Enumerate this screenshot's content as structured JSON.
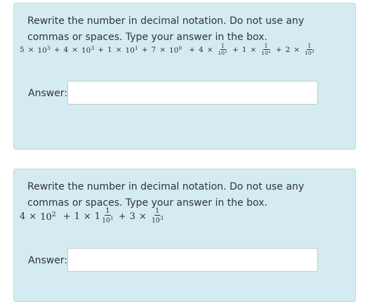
{
  "questions": [
    {
      "prompt": "Rewrite the number in decimal notation. Do not use any commas or spaces. Type your answer in the box.",
      "expression": {
        "t1_coef": "5",
        "t1_base": "10",
        "t1_exp": "3",
        "t2_coef": "4",
        "t2_base": "10",
        "t2_exp": "3",
        "t3_coef": "1",
        "t3_base": "10",
        "t3_exp": "1",
        "t4_coef": "7",
        "t4_base": "10",
        "t4_exp": "0",
        "t5_coef": "4",
        "t5_num": "1",
        "t5_base": "10",
        "t5_exp": "1",
        "t6_coef": "1",
        "t6_num": "1",
        "t6_base": "10",
        "t6_exp": "2",
        "t7_coef": "2",
        "t7_num": "1",
        "t7_base": "10",
        "t7_exp": "3",
        "times": "×",
        "plus": "+"
      },
      "answer_label": "Answer:",
      "answer_value": ""
    },
    {
      "prompt": "Rewrite the number in decimal notation. Do not use any commas or spaces. Type your answer in the box.",
      "expression": {
        "t1_coef": "4",
        "t1_base": "10",
        "t1_exp": "2",
        "t2_coef": "1",
        "t2_whole": "1",
        "t2_num": "1",
        "t2_base": "10",
        "t2_exp": "1",
        "t3_coef": "3",
        "t3_num": "1",
        "t3_base": "10",
        "t3_exp": "3",
        "times": "×",
        "plus": "+"
      },
      "answer_label": "Answer:",
      "answer_value": ""
    }
  ]
}
